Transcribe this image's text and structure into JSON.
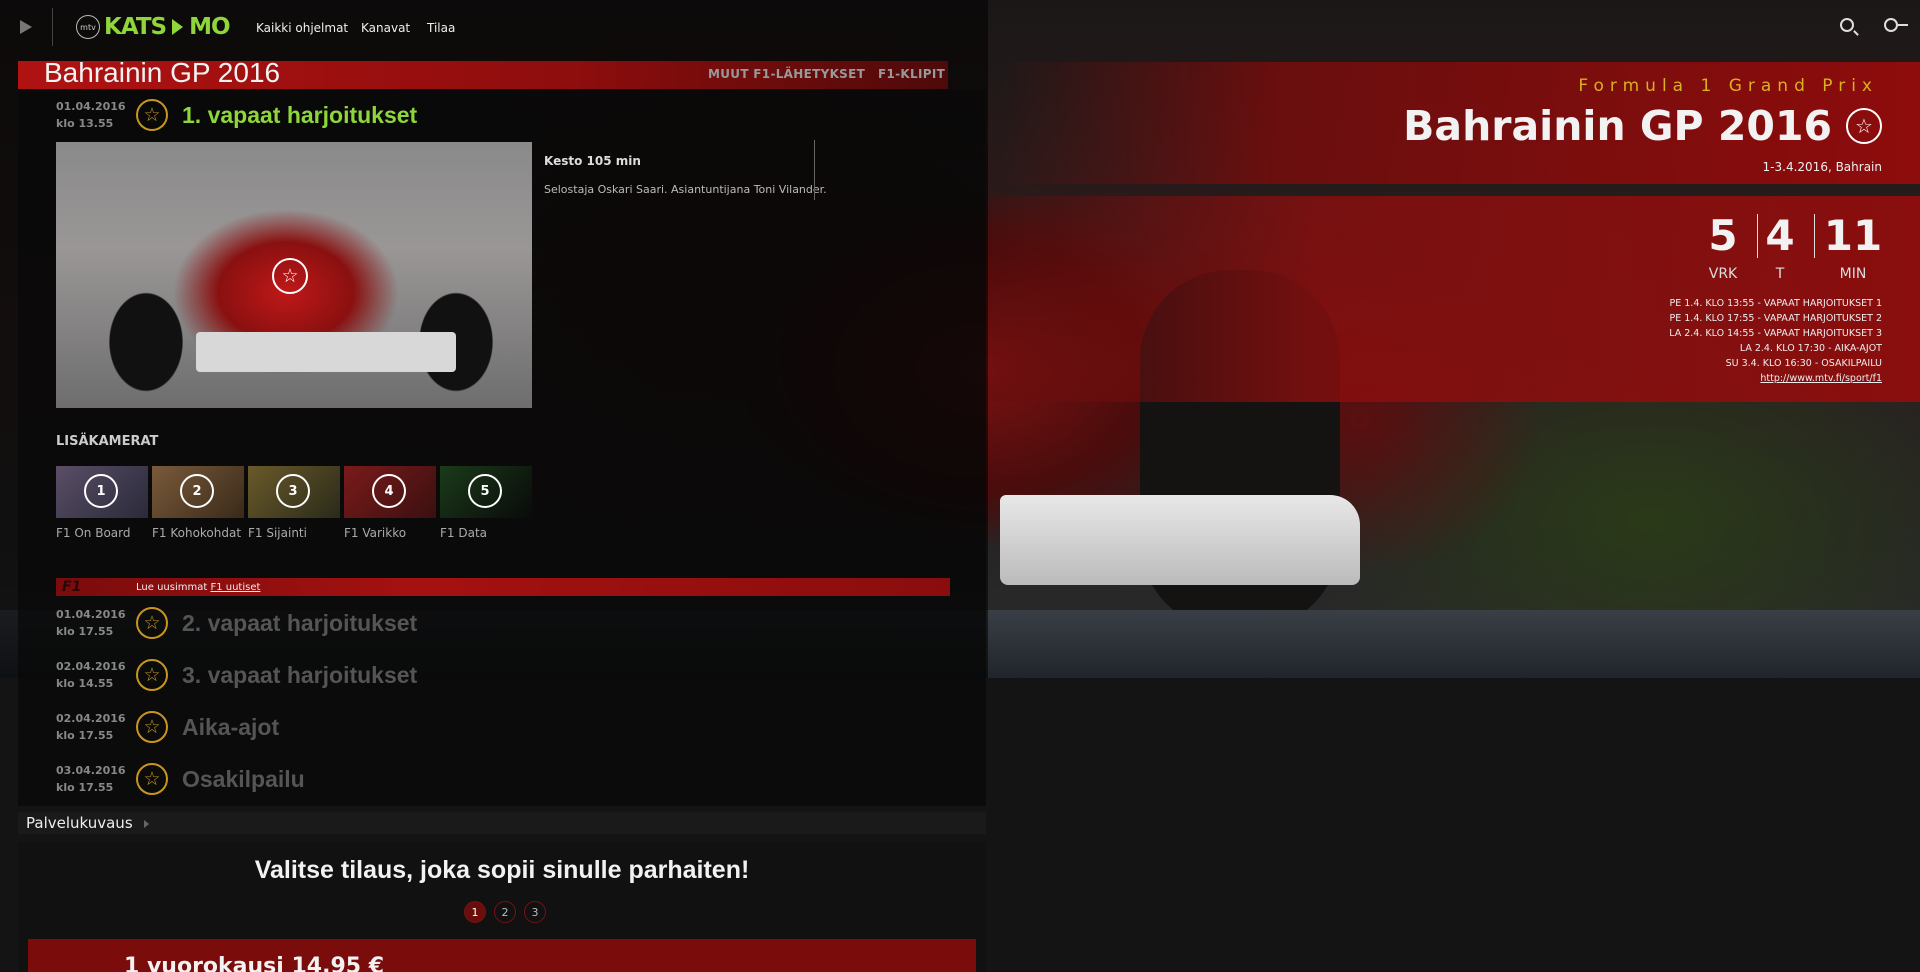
{
  "header": {
    "logo_text_left": "KATS",
    "logo_text_right": "MO",
    "logo_badge": "mtv",
    "nav": [
      "Kaikki ohjelmat",
      "Kanavat",
      "Tilaa"
    ]
  },
  "event": {
    "title": "Bahrainin GP 2016",
    "tabs": [
      "MUUT F1-LÄHETYKSET",
      "F1-KLIPIT"
    ]
  },
  "sessions": [
    {
      "date": "01.04.2016",
      "time": "klo 13.55",
      "name": "1. vapaat harjoitukset",
      "active": true
    },
    {
      "date": "01.04.2016",
      "time": "klo 17.55",
      "name": "2. vapaat harjoitukset",
      "active": false
    },
    {
      "date": "02.04.2016",
      "time": "klo 14.55",
      "name": "3. vapaat harjoitukset",
      "active": false
    },
    {
      "date": "02.04.2016",
      "time": "klo 17.55",
      "name": "Aika-ajot",
      "active": false
    },
    {
      "date": "03.04.2016",
      "time": "klo 17.55",
      "name": "Osakilpailu",
      "active": false
    }
  ],
  "detail": {
    "duration": "Kesto 105 min",
    "description": "Selostaja Oskari Saari. Asiantuntijana Toni Vilander."
  },
  "cameras": {
    "heading": "LISÄKAMERAT",
    "items": [
      {
        "num": "1",
        "label": "F1 On Board"
      },
      {
        "num": "2",
        "label": "F1 Kohokohdat"
      },
      {
        "num": "3",
        "label": "F1 Sijainti"
      },
      {
        "num": "4",
        "label": "F1 Varikko"
      },
      {
        "num": "5",
        "label": "F1 Data"
      }
    ]
  },
  "news": {
    "logo": "F1",
    "prefix": "Lue uusimmat",
    "link": "F1 uutiset"
  },
  "info": {
    "subtitle": "Formula 1 Grand Prix",
    "title": "Bahrainin GP 2016",
    "dates": "1-3.4.2016, Bahrain",
    "countdown": [
      {
        "value": "5",
        "unit": "VRK"
      },
      {
        "value": "4",
        "unit": "T"
      },
      {
        "value": "11",
        "unit": "MIN"
      }
    ],
    "schedule": [
      "PE 1.4. KLO 13:55 - VAPAAT HARJOITUKSET 1",
      "PE 1.4. KLO 17:55 - VAPAAT HARJOITUKSET 2",
      "LA 2.4. KLO 14:55 - VAPAAT HARJOITUKSET 3",
      "LA 2.4. KLO 17:30 - AIKA-AJOT",
      "SU 3.4. KLO 16:30 - OSAKILPAILU"
    ],
    "link": "http://www.mtv.fi/sport/f1"
  },
  "bottom": {
    "section_label": "Palvelukuvaus",
    "heading": "Valitse tilaus, joka sopii sinulle parhaiten!",
    "pages": [
      "1",
      "2",
      "3"
    ],
    "price_text": "1 vuorokausi 14,95 €"
  },
  "colors": {
    "accent_green": "#8fd63a",
    "brand_red": "#8e0c0c",
    "gold": "#c8961e"
  },
  "icons": [
    "play-icon",
    "search-icon",
    "key-icon",
    "star-icon",
    "camera-icon"
  ]
}
